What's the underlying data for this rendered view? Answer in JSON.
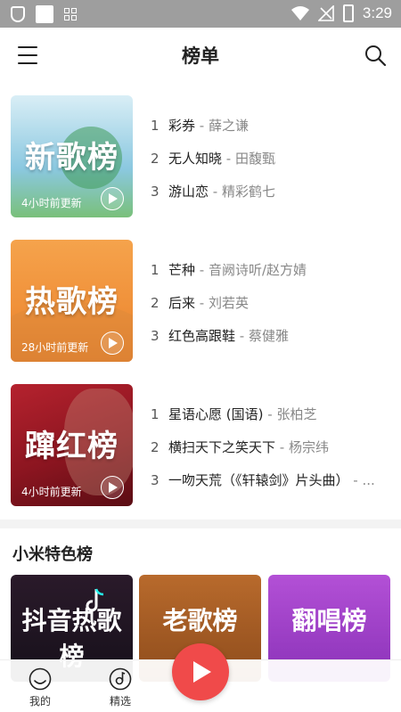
{
  "status_bar": {
    "time": "3:29"
  },
  "header": {
    "title": "榜单"
  },
  "rankings": [
    {
      "cover_title": "新歌榜",
      "update_text": "4小时前更新",
      "tracks": [
        {
          "num": "1",
          "song": "彩券",
          "artist": "薛之谦"
        },
        {
          "num": "2",
          "song": "无人知晓",
          "artist": "田馥甄"
        },
        {
          "num": "3",
          "song": "游山恋",
          "artist": "精彩鹤七"
        }
      ]
    },
    {
      "cover_title": "热歌榜",
      "update_text": "28小时前更新",
      "tracks": [
        {
          "num": "1",
          "song": "芒种",
          "artist": "音阙诗听/赵方婧"
        },
        {
          "num": "2",
          "song": "后来",
          "artist": "刘若英"
        },
        {
          "num": "3",
          "song": "红色高跟鞋",
          "artist": "蔡健雅"
        }
      ]
    },
    {
      "cover_title": "蹿红榜",
      "update_text": "4小时前更新",
      "tracks": [
        {
          "num": "1",
          "song": "星语心愿 (国语)",
          "artist": "张柏芝"
        },
        {
          "num": "2",
          "song": "横扫天下之笑天下",
          "artist": "杨宗纬"
        },
        {
          "num": "3",
          "song": "一吻天荒（《轩辕剑》片头曲）",
          "artist": "..."
        }
      ]
    }
  ],
  "section": {
    "title": "小米特色榜"
  },
  "featured": [
    {
      "title": "抖音热歌榜"
    },
    {
      "title": "老歌榜"
    },
    {
      "title": "翻唱榜"
    }
  ],
  "bottom_nav": {
    "me_label": "我的",
    "featured_label": "精选"
  },
  "colors": {
    "accent": "#f04a4a",
    "status_bar": "#9e9e9e"
  }
}
